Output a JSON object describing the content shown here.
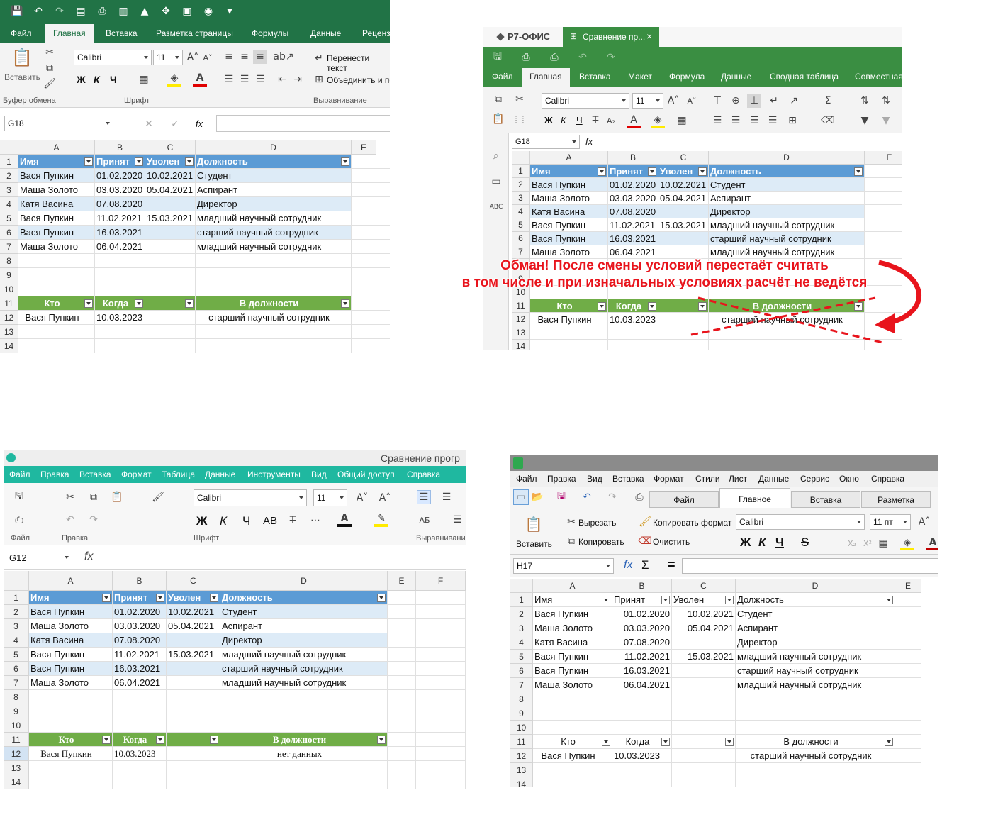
{
  "excel": {
    "tabs": [
      "Файл",
      "Главная",
      "Вставка",
      "Разметка страницы",
      "Формулы",
      "Данные",
      "Реценз"
    ],
    "paste_label": "Вставить",
    "font_name": "Calibri",
    "font_size": "11",
    "bold": "Ж",
    "italic": "К",
    "underline": "Ч",
    "wrap_text": "Перенести текст",
    "merge": "Объединить и по",
    "groups": {
      "clipboard": "Буфер обмена",
      "font": "Шрифт",
      "align": "Выравнивание"
    },
    "name_box": "G18",
    "fx": "fx",
    "cols": [
      "A",
      "B",
      "C",
      "D",
      "E"
    ],
    "rows": [
      "1",
      "2",
      "3",
      "4",
      "5",
      "6",
      "7",
      "8",
      "9",
      "10",
      "11",
      "12",
      "13",
      "14"
    ],
    "header": [
      "Имя",
      "Принят",
      "Уволен",
      "Должность"
    ],
    "data": [
      [
        "Вася Пупкин",
        "01.02.2020",
        "10.02.2021",
        "Студент"
      ],
      [
        "Маша Золото",
        "03.03.2020",
        "05.04.2021",
        "Аспирант"
      ],
      [
        "Катя Васина",
        "07.08.2020",
        "",
        "Директор"
      ],
      [
        "Вася Пупкин",
        "11.02.2021",
        "15.03.2021",
        "младший научный сотрудник"
      ],
      [
        "Вася Пупкин",
        "16.03.2021",
        "",
        "старший научный сотрудник"
      ],
      [
        "Маша Золото",
        "06.04.2021",
        "",
        "младший научный сотрудник"
      ]
    ],
    "sub_header": [
      "Кто",
      "Когда",
      "",
      "В должности"
    ],
    "sub_row": [
      "Вася Пупкин",
      "10.03.2023",
      "",
      "старший научный сотрудник"
    ]
  },
  "r7": {
    "brand": "Р7-ОФИС",
    "doc_tab": "Сравнение пр...",
    "close": "×",
    "tabs": [
      "Файл",
      "Главная",
      "Вставка",
      "Макет",
      "Формула",
      "Данные",
      "Сводная таблица",
      "Совместная"
    ],
    "font_name": "Calibri",
    "font_size": "11",
    "bold": "Ж",
    "italic": "К",
    "underline": "Ч",
    "name_box": "G18",
    "fx": "fx",
    "cols": [
      "A",
      "B",
      "C",
      "D",
      "E"
    ],
    "rows": [
      "1",
      "2",
      "3",
      "4",
      "5",
      "6",
      "7",
      "8",
      "9",
      "10",
      "11",
      "12",
      "13",
      "14"
    ],
    "header": [
      "Имя",
      "Принят",
      "Уволен",
      "Должность"
    ],
    "data": [
      [
        "Вася Пупкин",
        "01.02.2020",
        "10.02.2021",
        "Студент"
      ],
      [
        "Маша Золото",
        "03.03.2020",
        "05.04.2021",
        "Аспирант"
      ],
      [
        "Катя Васина",
        "07.08.2020",
        "",
        "Директор"
      ],
      [
        "Вася Пупкин",
        "11.02.2021",
        "15.03.2021",
        "младший научный сотрудник"
      ],
      [
        "Вася Пупкин",
        "16.03.2021",
        "",
        "старший научный сотрудник"
      ],
      [
        "Маша Золото",
        "06.04.2021",
        "",
        "младший научный сотрудник"
      ]
    ],
    "sub_header": [
      "Кто",
      "Когда",
      "",
      "В должности"
    ],
    "sub_row": [
      "Вася Пупкин",
      "10.03.2023",
      "",
      "старший научный сотрудник"
    ]
  },
  "annotation": {
    "line1": "Обман! После смены условий перестаёт считать",
    "line2": "в том числе и при изначальных условиях расчёт не ведётся",
    "color": "#e8141c"
  },
  "myoffice": {
    "title": "Сравнение прогр",
    "menu": [
      "Файл",
      "Правка",
      "Вставка",
      "Формат",
      "Таблица",
      "Данные",
      "Инструменты",
      "Вид",
      "Общий доступ",
      "Справка"
    ],
    "font_name": "Calibri",
    "font_size": "11",
    "bold": "Ж",
    "italic": "К",
    "underline": "Ч",
    "caps": "АВ",
    "groups": {
      "file": "Файл",
      "edit": "Правка",
      "font": "Шрифт",
      "align": "Выравнивани"
    },
    "name_box": "G12",
    "fx": "fx",
    "cols": [
      "A",
      "B",
      "C",
      "D",
      "E",
      "F"
    ],
    "rows": [
      "1",
      "2",
      "3",
      "4",
      "5",
      "6",
      "7",
      "8",
      "9",
      "10",
      "11",
      "12",
      "13",
      "14"
    ],
    "header": [
      "Имя",
      "Принят",
      "Уволен",
      "Должность"
    ],
    "data": [
      [
        "Вася Пупкин",
        "01.02.2020",
        "10.02.2021",
        "Студент"
      ],
      [
        "Маша Золото",
        "03.03.2020",
        "05.04.2021",
        "Аспирант"
      ],
      [
        "Катя Васина",
        "07.08.2020",
        "",
        "Директор"
      ],
      [
        "Вася Пупкин",
        "11.02.2021",
        "15.03.2021",
        "младший научный сотрудник"
      ],
      [
        "Вася Пупкин",
        "16.03.2021",
        "",
        "старший научный сотрудник"
      ],
      [
        "Маша Золото",
        "06.04.2021",
        "",
        "младший научный сотрудник"
      ]
    ],
    "sub_header": [
      "Кто",
      "Когда",
      "",
      "В должности"
    ],
    "sub_row": [
      "Вася Пупкин",
      "10.03.2023",
      "",
      "нет данных"
    ]
  },
  "libre": {
    "menu": [
      "Файл",
      "Правка",
      "Вид",
      "Вставка",
      "Формат",
      "Стили",
      "Лист",
      "Данные",
      "Сервис",
      "Окно",
      "Справка"
    ],
    "tabs": [
      "Файл",
      "Главное",
      "Вставка",
      "Разметка"
    ],
    "paste": "Вставить",
    "cut": "Вырезать",
    "copy": "Копировать",
    "clone": "Копировать формат",
    "clear": "Очистить",
    "font_name": "Calibri",
    "font_size": "11 пт",
    "bold": "Ж",
    "italic": "К",
    "underline": "Ч",
    "strike": "S",
    "name_box": "H17",
    "fx": "fx",
    "sum": "Σ",
    "eq": "=",
    "cols": [
      "A",
      "B",
      "C",
      "D",
      "E"
    ],
    "rows": [
      "1",
      "2",
      "3",
      "4",
      "5",
      "6",
      "7",
      "8",
      "9",
      "10",
      "11",
      "12",
      "13",
      "14"
    ],
    "header": [
      "Имя",
      "Принят",
      "Уволен",
      "Должность"
    ],
    "data": [
      [
        "Вася Пупкин",
        "01.02.2020",
        "10.02.2021",
        "Студент"
      ],
      [
        "Маша Золото",
        "03.03.2020",
        "05.04.2021",
        "Аспирант"
      ],
      [
        "Катя Васина",
        "07.08.2020",
        "",
        "Директор"
      ],
      [
        "Вася Пупкин",
        "11.02.2021",
        "15.03.2021",
        "младший научный сотрудник"
      ],
      [
        "Вася Пупкин",
        "16.03.2021",
        "",
        "старший научный сотрудник"
      ],
      [
        "Маша Золото",
        "06.04.2021",
        "",
        "младший научный сотрудник"
      ]
    ],
    "sub_header": [
      "Кто",
      "Когда",
      "",
      "В должности"
    ],
    "sub_row": [
      "Вася Пупкин",
      "10.03.2023",
      "",
      "старший научный сотрудник"
    ]
  },
  "colors": {
    "excel_green": "#217346",
    "r7_green": "#3a8e42",
    "myoffice_teal": "#1fb8a0",
    "table_blue": "#5b9bd5",
    "table_green": "#70ad47",
    "band_blue": "#ddebf7"
  }
}
